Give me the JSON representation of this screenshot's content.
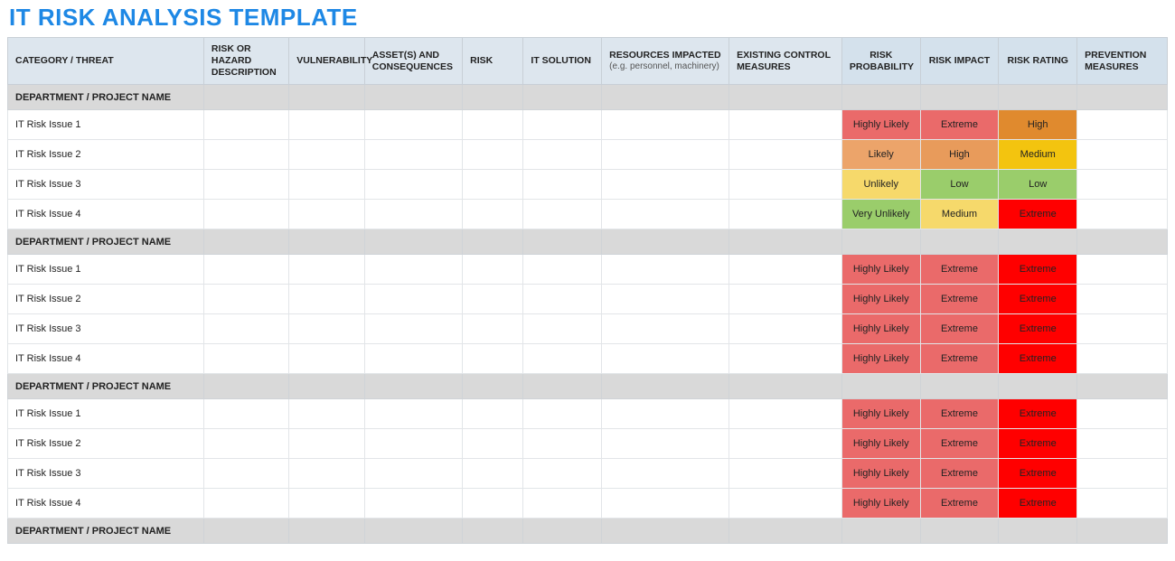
{
  "title": "IT RISK ANALYSIS TEMPLATE",
  "headers": {
    "category": "CATEGORY / THREAT",
    "hazard": "RISK OR HAZARD DESCRIPTION",
    "vulnerability": "VULNERABILITY",
    "assets": "ASSET(S) AND CONSEQUENCES",
    "risk": "RISK",
    "solution": "IT SOLUTION",
    "resources": "RESOURCES IMPACTED",
    "resources_sub": "(e.g. personnel, machinery)",
    "existing": "EXISTING CONTROL MEASURES",
    "probability": "RISK PROBABILITY",
    "impact": "RISK IMPACT",
    "rating": "RISK RATING",
    "prevention": "PREVENTION MEASURES"
  },
  "dept_label": "DEPARTMENT / PROJECT NAME",
  "groups": [
    {
      "rows": [
        {
          "name": "IT Risk Issue 1",
          "prob": "Highly Likely",
          "prob_c": "c-highlylikely",
          "imp": "Extreme",
          "imp_c": "c-extreme-i",
          "rat": "High",
          "rat_c": "c-high-r"
        },
        {
          "name": "IT Risk Issue 2",
          "prob": "Likely",
          "prob_c": "c-likely",
          "imp": "High",
          "imp_c": "c-high-i",
          "rat": "Medium",
          "rat_c": "c-medium-r"
        },
        {
          "name": "IT Risk Issue 3",
          "prob": "Unlikely",
          "prob_c": "c-unlikely",
          "imp": "Low",
          "imp_c": "c-low-i",
          "rat": "Low",
          "rat_c": "c-low-r"
        },
        {
          "name": "IT Risk Issue 4",
          "prob": "Very Unlikely",
          "prob_c": "c-veryunlikely",
          "imp": "Medium",
          "imp_c": "c-medium-i",
          "rat": "Extreme",
          "rat_c": "c-extreme-r"
        }
      ]
    },
    {
      "rows": [
        {
          "name": "IT Risk Issue 1",
          "prob": "Highly Likely",
          "prob_c": "c-highlylikely",
          "imp": "Extreme",
          "imp_c": "c-extreme-i",
          "rat": "Extreme",
          "rat_c": "c-extreme-r"
        },
        {
          "name": "IT Risk Issue 2",
          "prob": "Highly Likely",
          "prob_c": "c-highlylikely",
          "imp": "Extreme",
          "imp_c": "c-extreme-i",
          "rat": "Extreme",
          "rat_c": "c-extreme-r"
        },
        {
          "name": "IT Risk Issue 3",
          "prob": "Highly Likely",
          "prob_c": "c-highlylikely",
          "imp": "Extreme",
          "imp_c": "c-extreme-i",
          "rat": "Extreme",
          "rat_c": "c-extreme-r"
        },
        {
          "name": "IT Risk Issue 4",
          "prob": "Highly Likely",
          "prob_c": "c-highlylikely",
          "imp": "Extreme",
          "imp_c": "c-extreme-i",
          "rat": "Extreme",
          "rat_c": "c-extreme-r"
        }
      ]
    },
    {
      "rows": [
        {
          "name": "IT Risk Issue 1",
          "prob": "Highly Likely",
          "prob_c": "c-highlylikely",
          "imp": "Extreme",
          "imp_c": "c-extreme-i",
          "rat": "Extreme",
          "rat_c": "c-extreme-r"
        },
        {
          "name": "IT Risk Issue 2",
          "prob": "Highly Likely",
          "prob_c": "c-highlylikely",
          "imp": "Extreme",
          "imp_c": "c-extreme-i",
          "rat": "Extreme",
          "rat_c": "c-extreme-r"
        },
        {
          "name": "IT Risk Issue 3",
          "prob": "Highly Likely",
          "prob_c": "c-highlylikely",
          "imp": "Extreme",
          "imp_c": "c-extreme-i",
          "rat": "Extreme",
          "rat_c": "c-extreme-r"
        },
        {
          "name": "IT Risk Issue 4",
          "prob": "Highly Likely",
          "prob_c": "c-highlylikely",
          "imp": "Extreme",
          "imp_c": "c-extreme-i",
          "rat": "Extreme",
          "rat_c": "c-extreme-r"
        }
      ]
    },
    {
      "rows": []
    }
  ]
}
